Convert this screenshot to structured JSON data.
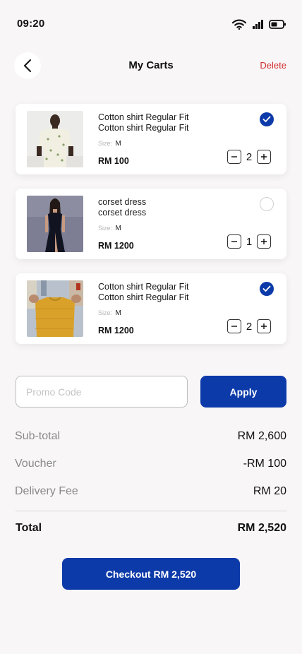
{
  "status_bar": {
    "time": "09:20",
    "icons": [
      "wifi-icon",
      "signal-icon",
      "battery-icon"
    ]
  },
  "header": {
    "back_icon": "chevron-left-icon",
    "title": "My Carts",
    "delete_label": "Delete"
  },
  "cart": {
    "items": [
      {
        "name_line1": "Cotton shirt Regular Fit",
        "name_line2": "Cotton shirt Regular Fit",
        "size_label": "Size:",
        "size_value": "M",
        "price": "RM 100",
        "quantity": "2",
        "selected": true
      },
      {
        "name_line1": "corset dress",
        "name_line2": "corset dress",
        "size_label": "Size:",
        "size_value": "M",
        "price": "RM 1200",
        "quantity": "1",
        "selected": false
      },
      {
        "name_line1": "Cotton shirt Regular Fit",
        "name_line2": "Cotton shirt Regular Fit",
        "size_label": "Size:",
        "size_value": "M",
        "price": "RM 1200",
        "quantity": "2",
        "selected": true
      }
    ]
  },
  "promo": {
    "placeholder": "Promo Code",
    "value": "",
    "apply_label": "Apply"
  },
  "summary": {
    "subtotal_label": "Sub-total",
    "subtotal_value": "RM 2,600",
    "voucher_label": "Voucher",
    "voucher_value": "-RM 100",
    "delivery_label": "Delivery Fee",
    "delivery_value": "RM 20",
    "total_label": "Total",
    "total_value": "RM 2,520"
  },
  "checkout": {
    "label": "Checkout RM 2,520"
  },
  "colors": {
    "accent": "#0d3aa9",
    "delete": "#d32f2f",
    "background": "#f8f6f7"
  }
}
